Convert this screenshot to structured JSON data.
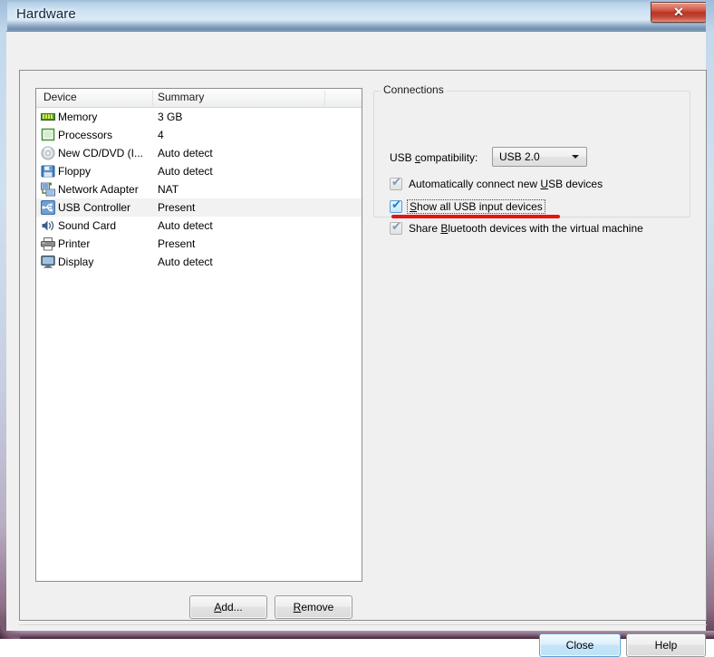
{
  "window": {
    "title": "Hardware",
    "close_icon": "close-icon",
    "close_glyph": "✕"
  },
  "device_list": {
    "columns": [
      "Device",
      "Summary"
    ],
    "rows": [
      {
        "icon": "memory-icon",
        "name": "Memory",
        "summary": "3 GB",
        "selected": false
      },
      {
        "icon": "processor-icon",
        "name": "Processors",
        "summary": "4",
        "selected": false
      },
      {
        "icon": "cd-dvd-icon",
        "name": "New CD/DVD (I...",
        "summary": "Auto detect",
        "selected": false
      },
      {
        "icon": "floppy-icon",
        "name": "Floppy",
        "summary": "Auto detect",
        "selected": false
      },
      {
        "icon": "network-adapter-icon",
        "name": "Network Adapter",
        "summary": "NAT",
        "selected": false
      },
      {
        "icon": "usb-controller-icon",
        "name": "USB Controller",
        "summary": "Present",
        "selected": true
      },
      {
        "icon": "sound-card-icon",
        "name": "Sound Card",
        "summary": "Auto detect",
        "selected": false
      },
      {
        "icon": "printer-icon",
        "name": "Printer",
        "summary": "Present",
        "selected": false
      },
      {
        "icon": "display-icon",
        "name": "Display",
        "summary": "Auto detect",
        "selected": false
      }
    ]
  },
  "list_buttons": {
    "add_label": "Add...",
    "add_accel": "A",
    "remove_label": "Remove",
    "remove_accel": "R"
  },
  "connections": {
    "legend": "Connections",
    "usb_compatibility_label": "USB compatibility:",
    "usb_compatibility_accel": "c",
    "usb_compatibility_value": "USB 2.0",
    "usb_compatibility_options": [
      "USB 2.0"
    ],
    "dropdown_icon": "chevron-down-icon",
    "checkboxes": [
      {
        "label": "Automatically connect new USB devices",
        "accel": "U",
        "checked": true,
        "focused": false,
        "name": "auto-connect-new-usb-devices"
      },
      {
        "label": "Show all USB input devices",
        "accel": "S",
        "checked": true,
        "focused": true,
        "name": "show-all-usb-input-devices"
      },
      {
        "label": "Share Bluetooth devices with the virtual machine",
        "accel": "B",
        "checked": true,
        "focused": false,
        "name": "share-bluetooth-devices"
      }
    ],
    "annotation": {
      "type": "underline",
      "color": "#e8140f",
      "target": "Show all USB input devices"
    }
  },
  "dialog_buttons": {
    "close_label": "Close",
    "help_label": "Help"
  },
  "colors": {
    "title_bar_glass": "#cfe2f2",
    "close_button_red": "#c84733",
    "default_button_blue": "#c4e5f8",
    "annotation_red": "#e8140f",
    "selected_row": "#f2f2f2"
  }
}
